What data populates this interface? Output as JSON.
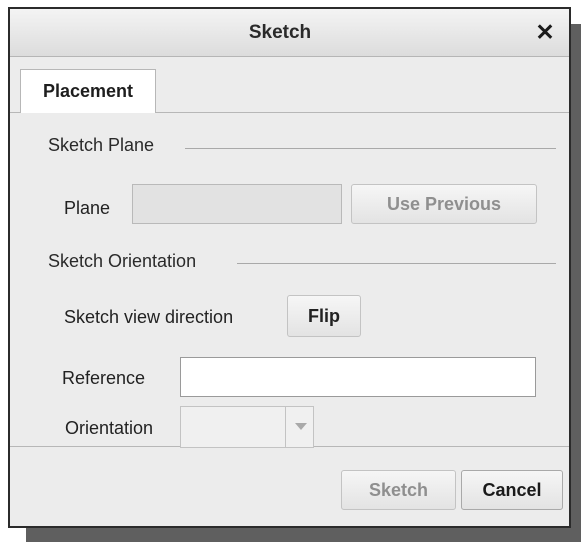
{
  "dialog": {
    "title": "Sketch",
    "close_icon": "close-icon"
  },
  "tabs": [
    {
      "label": "Placement",
      "active": true
    }
  ],
  "sketch_plane": {
    "group_label": "Sketch Plane",
    "plane_label": "Plane",
    "plane_value": "",
    "use_previous_label": "Use Previous"
  },
  "sketch_orientation": {
    "group_label": "Sketch Orientation",
    "view_direction_label": "Sketch view direction",
    "flip_label": "Flip",
    "reference_label": "Reference",
    "reference_value": "",
    "orientation_label": "Orientation",
    "orientation_value": ""
  },
  "footer": {
    "sketch_label": "Sketch",
    "cancel_label": "Cancel"
  }
}
